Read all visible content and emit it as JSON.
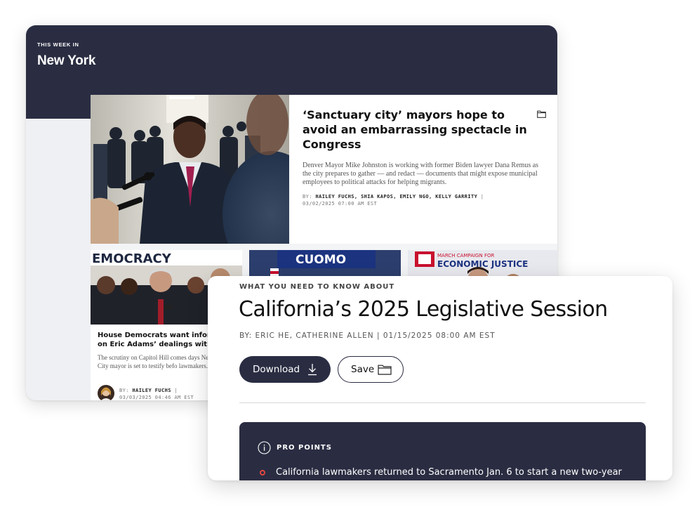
{
  "section": {
    "kicker": "THIS WEEK IN",
    "title": "New York"
  },
  "feature": {
    "headline": "‘Sanctuary city’ mayors hope to avoid an embarrassing spectacle in Congress",
    "dek": "Denver Mayor Mike Johnston is working with former Biden lawyer Dana Remus as the city prepares to gather — and redact — documents that might expose municipal employees to political attacks for helping migrants.",
    "by_label": "BY:",
    "authors": "HAILEY FUCHS, SHIA KAPOS, EMILY NGO, KELLY GARRITY",
    "separator": " | ",
    "timestamp": "03/02/2025 07:00 AM EST",
    "save_icon": "folder-icon"
  },
  "thumbnails": [
    {
      "sign_text": "EMOCRACY"
    },
    {
      "sign_text": "CUOMO"
    },
    {
      "sign_line1": "MARCH CAMPAIGN FOR",
      "sign_line2": "ECONOMIC JUSTICE"
    }
  ],
  "story1": {
    "headline": "House Democrats want informati on Eric Adams’ dealings with DO",
    "dek": "The scrutiny on Capitol Hill comes days New York City mayor is set to testify befo lawmakers.",
    "by_label": "BY:",
    "author": "HAILEY FUCHS",
    "separator": " |",
    "timestamp": "03/03/2025 04:46 AM EST"
  },
  "brief": {
    "kicker": "WHAT YOU NEED TO KNOW ABOUT",
    "title": "California’s 2025 Legislative Session",
    "byline": "BY: ERIC HE, CATHERINE ALLEN | 01/15/2025 08:00 AM EST",
    "download_label": "Download",
    "save_label": "Save",
    "download_icon": "download-icon",
    "save_icon": "folder-icon"
  },
  "pro_points": {
    "label": "PRO POINTS",
    "icon": "info-icon",
    "items": [
      "California lawmakers returned to Sacramento Jan. 6 to start a new two-year"
    ]
  },
  "colors": {
    "navy": "#2a2d42",
    "bullet_red": "#e0463f",
    "page_bg": "#ffffff"
  }
}
